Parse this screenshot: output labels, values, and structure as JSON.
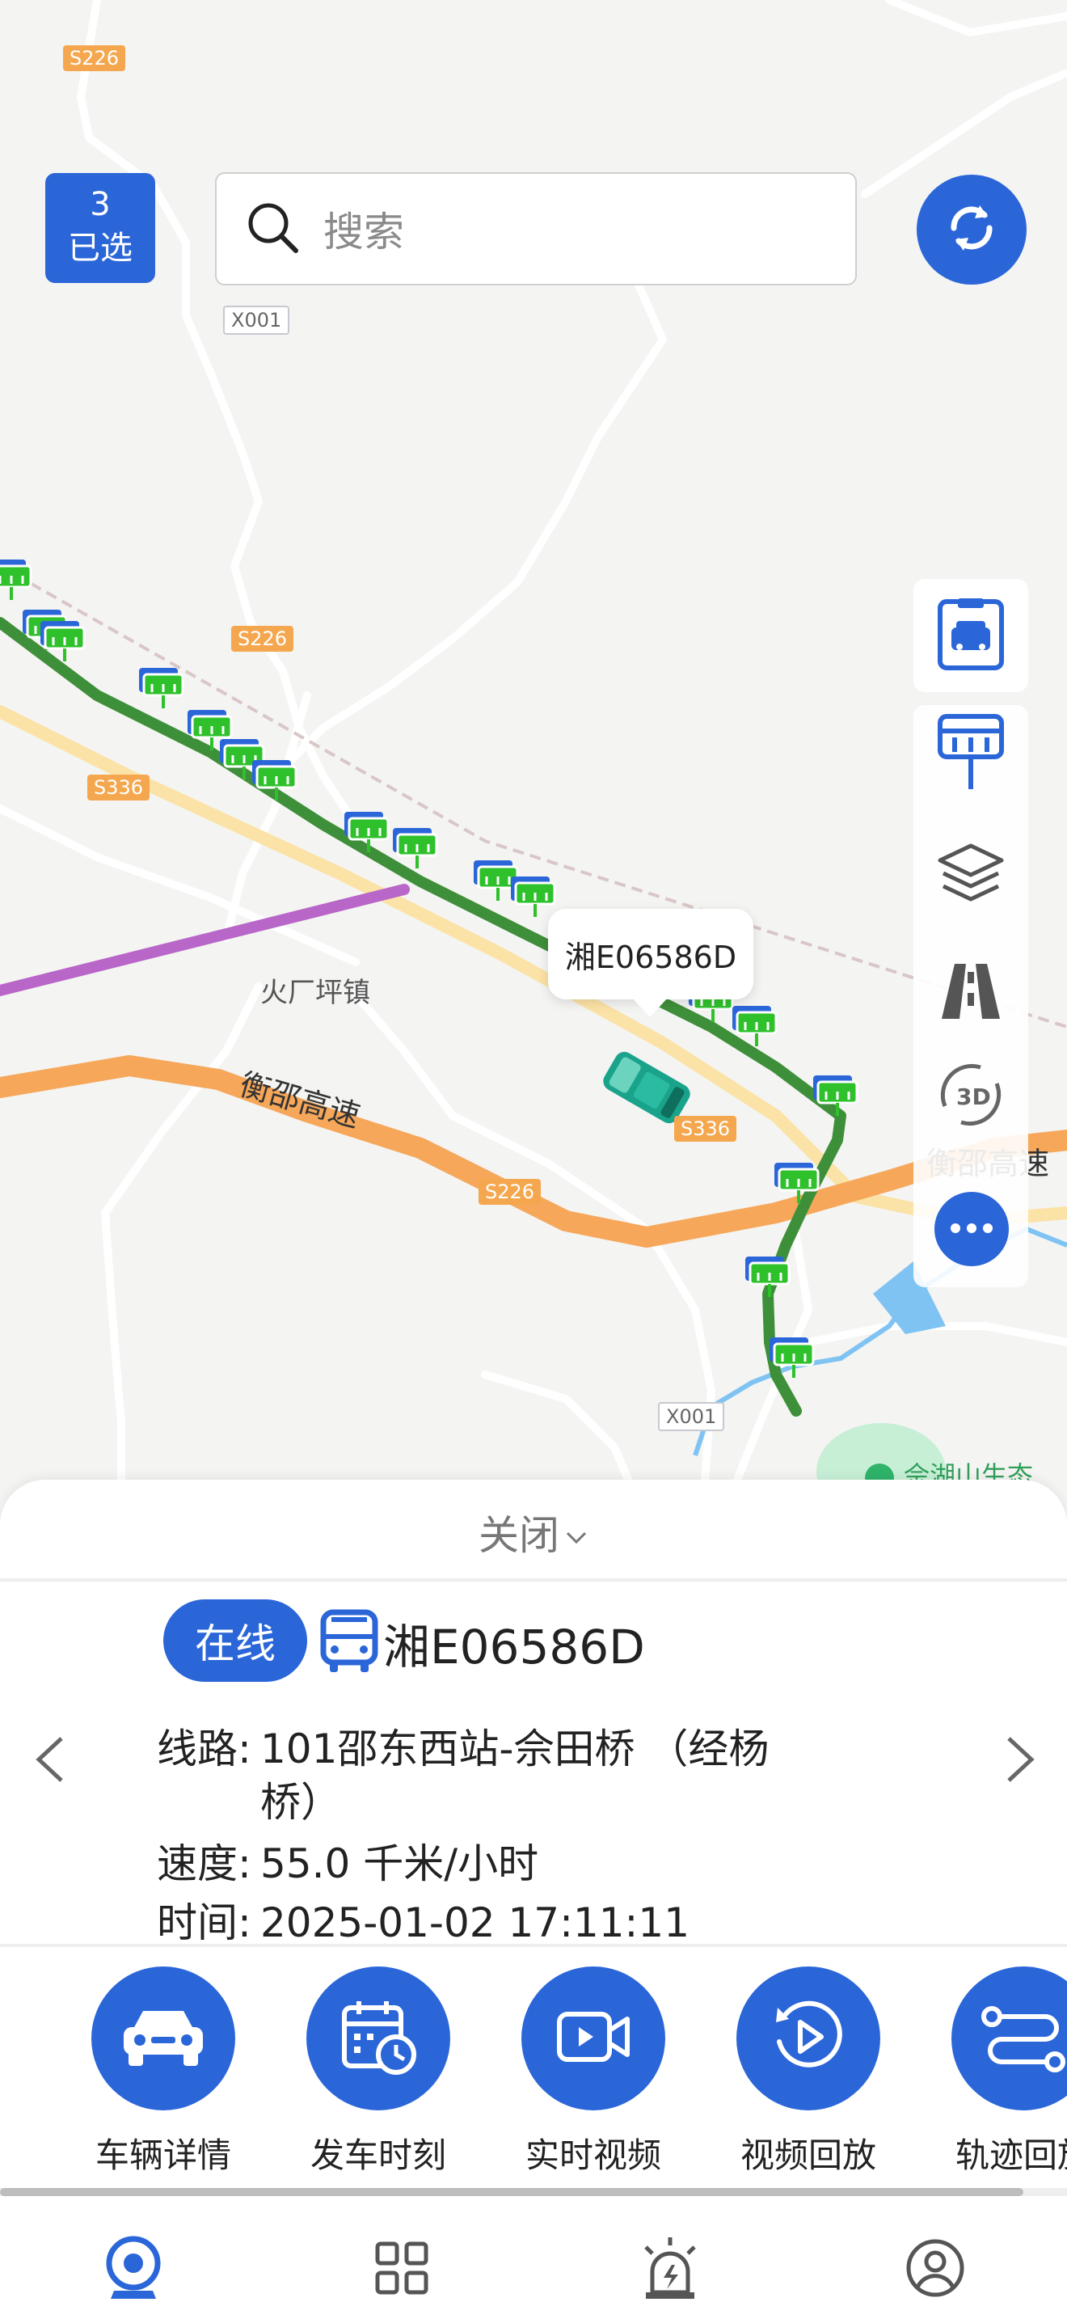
{
  "map": {
    "town_label": "火厂坪镇",
    "highway_label_1": "衡邵高速",
    "highway_label_2": "衡邵高速",
    "park_label": "佘湖山生态",
    "road_tags": [
      "S226",
      "S226",
      "S226",
      "S336",
      "S336",
      "S226",
      "X001",
      "X001"
    ],
    "vehicle_popup": "湘E06586D"
  },
  "selection": {
    "count": "3",
    "label": "已选"
  },
  "search": {
    "placeholder": "搜索"
  },
  "panel": {
    "close_label": "关闭",
    "status": "在线",
    "plate": "湘E06586D",
    "route_key": "线路:",
    "route_value": "101邵东西站-佘田桥 （经杨",
    "route_value_2": "桥）",
    "speed_key": "速度:",
    "speed_value": "55.0 千米/小时",
    "time_key": "时间:",
    "time_value": "2025-01-02 17:11:11"
  },
  "actions": [
    {
      "label": "车辆详情",
      "icon": "car-icon"
    },
    {
      "label": "发车时刻",
      "icon": "calendar-clock-icon"
    },
    {
      "label": "实时视频",
      "icon": "video-icon"
    },
    {
      "label": "视频回放",
      "icon": "replay-icon"
    },
    {
      "label": "轨迹回放",
      "icon": "route-icon"
    }
  ],
  "colors": {
    "accent": "#2b66d9",
    "route": "#3e8f3a",
    "stop_green": "#2fc12c",
    "highway": "#f6a75a",
    "purple_line": "#b866c8"
  }
}
